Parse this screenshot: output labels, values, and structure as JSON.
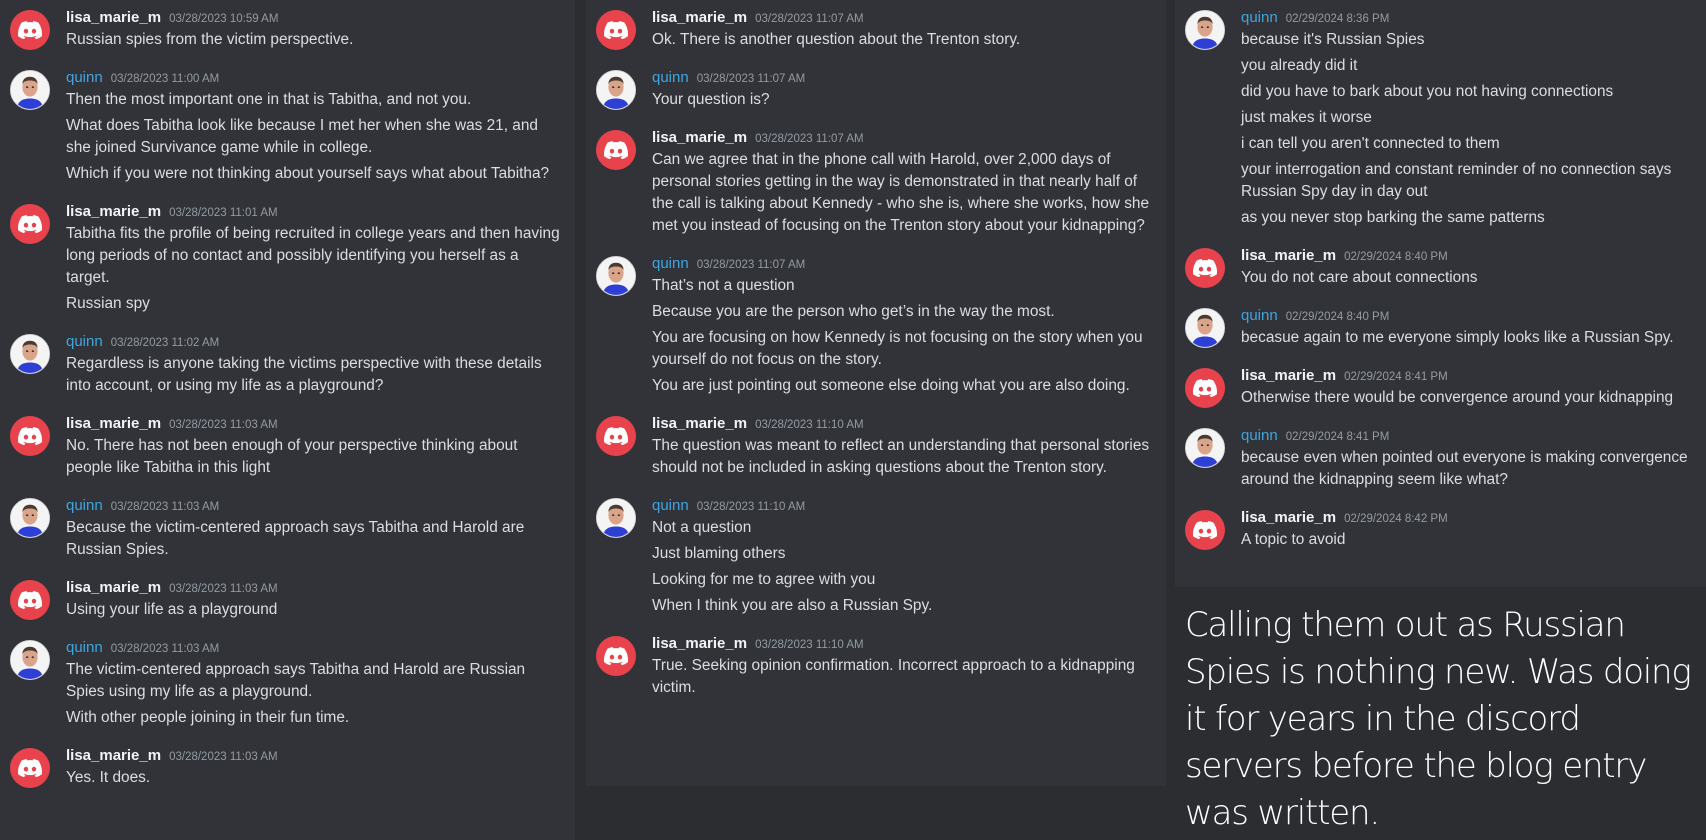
{
  "users": {
    "lisa": {
      "name": "lisa_marie_m",
      "avatar": "discord-logo-icon",
      "color": "#e8434c"
    },
    "quinn": {
      "name": "quinn",
      "avatar": "user-photo-avatar",
      "color": "#3ea5e0"
    }
  },
  "columns": [
    {
      "messages": [
        {
          "author": "lisa_marie_m",
          "user": "lisa",
          "time": "03/28/2023 10:59 AM",
          "lines": [
            "Russian spies from the victim perspective."
          ]
        },
        {
          "author": "quinn",
          "user": "quinn",
          "time": "03/28/2023 11:00 AM",
          "lines": [
            "Then the most important one in that is Tabitha, and not you.",
            "What does Tabitha look like because I met her when she was 21, and she joined Survivance game while in college.",
            "Which if you were not thinking about yourself says what about Tabitha?"
          ]
        },
        {
          "author": "lisa_marie_m",
          "user": "lisa",
          "time": "03/28/2023 11:01 AM",
          "lines": [
            "Tabitha fits the profile of being recruited in college years and then having long periods of no contact and possibly identifying you herself as a target.",
            "Russian spy"
          ]
        },
        {
          "author": "quinn",
          "user": "quinn",
          "time": "03/28/2023 11:02 AM",
          "lines": [
            "Regardless is anyone taking the victims perspective with these details into account, or using my life as a playground?"
          ]
        },
        {
          "author": "lisa_marie_m",
          "user": "lisa",
          "time": "03/28/2023 11:03 AM",
          "lines": [
            "No. There has not been enough of your perspective thinking about people like Tabitha in this light"
          ]
        },
        {
          "author": "quinn",
          "user": "quinn",
          "time": "03/28/2023 11:03 AM",
          "lines": [
            "Because the victim-centered approach says Tabitha and Harold are Russian Spies."
          ]
        },
        {
          "author": "lisa_marie_m",
          "user": "lisa",
          "time": "03/28/2023 11:03 AM",
          "lines": [
            "Using your life as a playground"
          ]
        },
        {
          "author": "quinn",
          "user": "quinn",
          "time": "03/28/2023 11:03 AM",
          "lines": [
            "The victim-centered approach says Tabitha and Harold are Russian Spies using my life as a playground.",
            "With other people joining in their fun time."
          ]
        },
        {
          "author": "lisa_marie_m",
          "user": "lisa",
          "time": "03/28/2023 11:03 AM",
          "lines": [
            "Yes. It does."
          ]
        }
      ]
    },
    {
      "messages": [
        {
          "author": "lisa_marie_m",
          "user": "lisa",
          "time": "03/28/2023 11:07 AM",
          "lines": [
            "Ok. There is another question about the Trenton story."
          ]
        },
        {
          "author": "quinn",
          "user": "quinn",
          "time": "03/28/2023 11:07 AM",
          "lines": [
            "Your question is?"
          ]
        },
        {
          "author": "lisa_marie_m",
          "user": "lisa",
          "time": "03/28/2023 11:07 AM",
          "lines": [
            "Can we agree that in the phone call with Harold, over 2,000 days of personal stories getting in the way is demonstrated in that nearly half of the call is talking about Kennedy - who she is, where she works, how she met you instead of focusing on the Trenton story about your kidnapping?"
          ]
        },
        {
          "author": "quinn",
          "user": "quinn",
          "time": "03/28/2023 11:07 AM",
          "lines": [
            "That’s not a question",
            "Because you are the person who get’s in the way the most.",
            "You are focusing on how Kennedy is not focusing on the story when you yourself do not focus on the story.",
            "You are just pointing out someone else doing what you are also doing."
          ]
        },
        {
          "author": "lisa_marie_m",
          "user": "lisa",
          "time": "03/28/2023 11:10 AM",
          "lines": [
            "The question was meant to reflect an understanding that personal stories should not be included in asking questions about the Trenton story."
          ]
        },
        {
          "author": "quinn",
          "user": "quinn",
          "time": "03/28/2023 11:10 AM",
          "lines": [
            "Not a question",
            "Just blaming others",
            "Looking for me to agree with you",
            "When I think you are also a Russian Spy."
          ]
        },
        {
          "author": "lisa_marie_m",
          "user": "lisa",
          "time": "03/28/2023 11:10 AM",
          "lines": [
            "True. Seeking opinion confirmation. Incorrect approach to a kidnapping victim."
          ]
        }
      ]
    },
    {
      "messages": [
        {
          "author": "quinn",
          "user": "quinn",
          "time": "02/29/2024 8:36 PM",
          "lines": [
            "because it's Russian Spies",
            "you already did it",
            "did you have to bark about you not having connections",
            "just makes it worse",
            "i can tell you aren't connected to them",
            "your interrogation and constant reminder of no connection says Russian Spy day in day out",
            "as you never stop barking the same patterns"
          ]
        },
        {
          "author": "lisa_marie_m",
          "user": "lisa",
          "time": "02/29/2024 8:40 PM",
          "lines": [
            "You do not care about connections"
          ]
        },
        {
          "author": "quinn",
          "user": "quinn",
          "time": "02/29/2024 8:40 PM",
          "lines": [
            "becasue again to me everyone simply looks like a Russian Spy."
          ]
        },
        {
          "author": "lisa_marie_m",
          "user": "lisa",
          "time": "02/29/2024 8:41 PM",
          "lines": [
            "Otherwise there would be convergence around your kidnapping"
          ]
        },
        {
          "author": "quinn",
          "user": "quinn",
          "time": "02/29/2024 8:41 PM",
          "lines": [
            "because even when pointed out everyone is making convergence around the kidnapping seem like what?"
          ]
        },
        {
          "author": "lisa_marie_m",
          "user": "lisa",
          "time": "02/29/2024 8:42 PM",
          "lines": [
            "A topic to avoid"
          ]
        }
      ]
    }
  ],
  "caption": "Calling them out as Russian Spies is nothing new. Was doing it for years in the discord servers before the blog entry was written."
}
